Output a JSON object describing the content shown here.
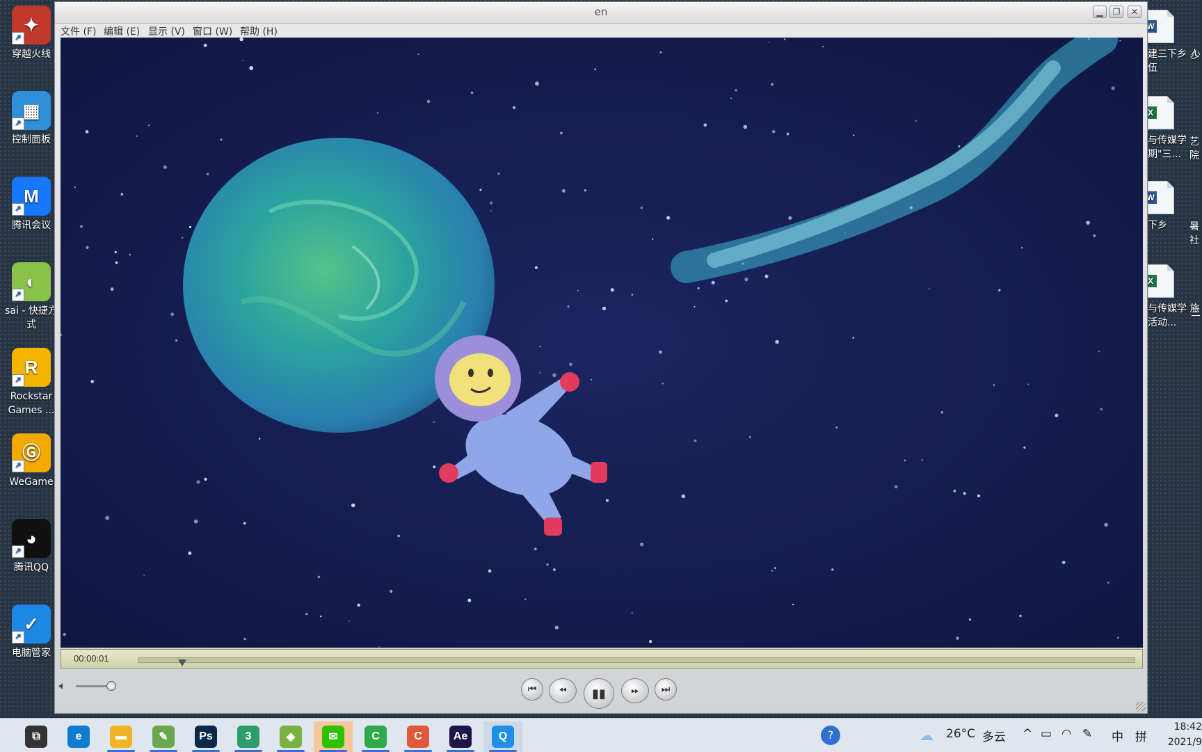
{
  "desktop": {
    "left_icons": [
      {
        "label": "穿越火线",
        "icon": "crossfire-icon",
        "color": "#c0392b"
      },
      {
        "label": "控制面板",
        "icon": "control-panel-icon",
        "color": "#2f8fd8"
      },
      {
        "label": "腾讯会议",
        "icon": "tencent-meeting-icon",
        "color": "#1677ff"
      },
      {
        "label": "sai - 快捷方式",
        "icon": "sai-icon",
        "color": "#8bc34a"
      },
      {
        "label": "Rockstar Games ...",
        "icon": "rockstar-icon",
        "color": "#f5b400"
      },
      {
        "label": "WeGame",
        "icon": "wegame-icon",
        "color": "#f2a900"
      },
      {
        "label": "腾讯QQ",
        "icon": "qq-icon",
        "color": "#111111"
      },
      {
        "label": "电脑管家",
        "icon": "pc-manager-icon",
        "color": "#1e88e5"
      }
    ],
    "right_icons": [
      {
        "label": "建三下乡 人伍",
        "type": "W"
      },
      {
        "label": "与传媒学 期\"三...",
        "type": "X"
      },
      {
        "label": "下乡",
        "type": "W"
      },
      {
        "label": "与传媒学 旅活动...",
        "type": "X"
      }
    ],
    "right_partial_labels": [
      "少",
      "艺 院",
      "暑 社",
      "三"
    ]
  },
  "player": {
    "title": "en",
    "menu": [
      "文件 (F)",
      "编辑 (E)",
      "显示 (V)",
      "窗口 (W)",
      "帮助 (H)"
    ],
    "timecode": "00:00:01",
    "progress": 0.04,
    "volume": 0.8,
    "controls": [
      "skip-back",
      "rewind",
      "play-pause",
      "fast-forward",
      "skip-forward"
    ],
    "colors": {
      "space": "#151d4a",
      "planet": "#3a9bb5",
      "astronaut": "#8fa7e8"
    }
  },
  "taskbar": {
    "apps": [
      {
        "name": "task-view-icon",
        "glyph": "⧉",
        "color": "#333333"
      },
      {
        "name": "edge-icon",
        "glyph": "e",
        "color": "#0f7ccf"
      },
      {
        "name": "file-explorer-icon",
        "glyph": "▬",
        "color": "#f0b429"
      },
      {
        "name": "pen-app-icon",
        "glyph": "✎",
        "color": "#6aa84f"
      },
      {
        "name": "photoshop-icon",
        "glyph": "Ps",
        "color": "#0b2a4a"
      },
      {
        "name": "3d-app-icon",
        "glyph": "3",
        "color": "#2e9d6b"
      },
      {
        "name": "sai-taskbar-icon",
        "glyph": "◈",
        "color": "#7bb043"
      },
      {
        "name": "wechat-icon",
        "glyph": "✉",
        "color": "#2dc100"
      },
      {
        "name": "camtasia-green-icon",
        "glyph": "C",
        "color": "#2faa4b"
      },
      {
        "name": "camtasia-red-icon",
        "glyph": "C",
        "color": "#e2583e"
      },
      {
        "name": "after-effects-icon",
        "glyph": "Ae",
        "color": "#1d1447"
      },
      {
        "name": "quicktime-icon",
        "glyph": "Q",
        "color": "#1f8fe6"
      }
    ],
    "tray": {
      "weather_temp": "26°C",
      "weather_text": "多云",
      "ime": "中",
      "ime2": "拼",
      "time": "18:42",
      "date": "2021/9"
    }
  }
}
